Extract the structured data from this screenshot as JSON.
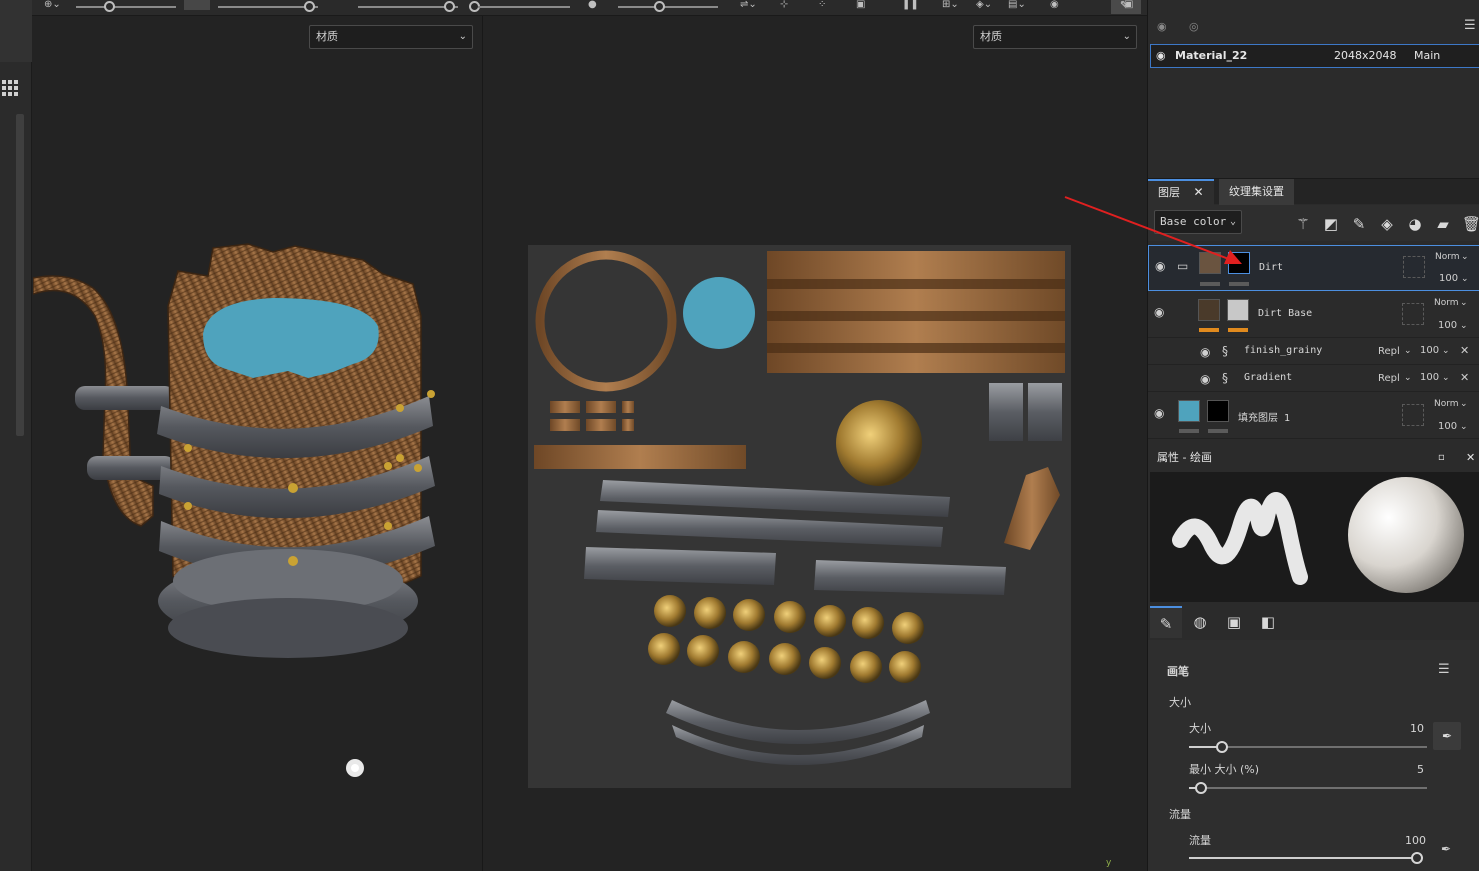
{
  "viewport3d": {
    "material_select": "材质"
  },
  "viewport2d": {
    "material_select": "材质"
  },
  "texture_set": {
    "name": "Material_22",
    "resolution": "2048x2048",
    "shader": "Main shader"
  },
  "tabs": {
    "layers": "图层",
    "texture_set_settings": "纹理集设置"
  },
  "layers_toolbar": {
    "channel": "Base color"
  },
  "layers": [
    {
      "name": "Dirt",
      "blend": "Norm",
      "opacity": "100"
    },
    {
      "name": "Dirt Base",
      "blend": "Norm",
      "opacity": "100"
    },
    {
      "name": "finish_grainy",
      "blend": "Repl",
      "opacity": "100"
    },
    {
      "name": "Gradient",
      "blend": "Repl",
      "opacity": "100"
    },
    {
      "name": "填充图层 1",
      "blend": "Norm",
      "opacity": "100"
    }
  ],
  "properties": {
    "title": "属性 - 绘画"
  },
  "brush": {
    "section": "画笔",
    "size_group": "大小",
    "size_label": "大小",
    "size_value": "10",
    "size_fraction": 0.14,
    "min_size_label": "最小 大小 (%)",
    "min_size_value": "5",
    "min_size_fraction": 0.05,
    "flow_group": "流量",
    "flow_label": "流量",
    "flow_value": "100",
    "flow_fraction": 1.0
  },
  "axis_label": "y",
  "colors": {
    "accent": "#4c8fe0",
    "orange": "#e08a1e",
    "arrow": "#e02020",
    "water": "#4fa3bd"
  }
}
